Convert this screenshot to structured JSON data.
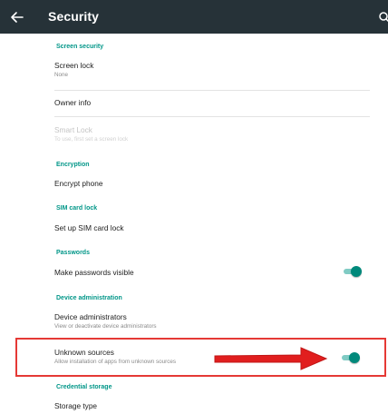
{
  "colors": {
    "appbar": "#263238",
    "accent": "#009688",
    "toggle_on": "#00897b",
    "highlight": "#e53935"
  },
  "appbar": {
    "title": "Security",
    "back_icon": "arrow-left",
    "search_icon": "search"
  },
  "sections": {
    "screen_security": {
      "header": "Screen security",
      "screen_lock": {
        "title": "Screen lock",
        "summary": "None"
      },
      "owner_info": {
        "title": "Owner info"
      },
      "smart_lock": {
        "title": "Smart Lock",
        "summary": "To use, first set a screen lock",
        "enabled": false
      }
    },
    "encryption": {
      "header": "Encryption",
      "encrypt_phone": {
        "title": "Encrypt phone"
      }
    },
    "sim_card_lock": {
      "header": "SIM card lock",
      "setup": {
        "title": "Set up SIM card lock"
      }
    },
    "passwords": {
      "header": "Passwords",
      "make_visible": {
        "title": "Make passwords visible",
        "toggle_on": true
      }
    },
    "device_administration": {
      "header": "Device administration",
      "device_admins": {
        "title": "Device administrators",
        "summary": "View or deactivate device administrators"
      },
      "unknown_sources": {
        "title": "Unknown sources",
        "summary": "Allow installation of apps from unknown sources",
        "toggle_on": true
      }
    },
    "credential_storage": {
      "header": "Credential storage",
      "storage_type": {
        "title": "Storage type"
      }
    }
  },
  "annotation": {
    "arrow_icon": "red-arrow-right"
  }
}
